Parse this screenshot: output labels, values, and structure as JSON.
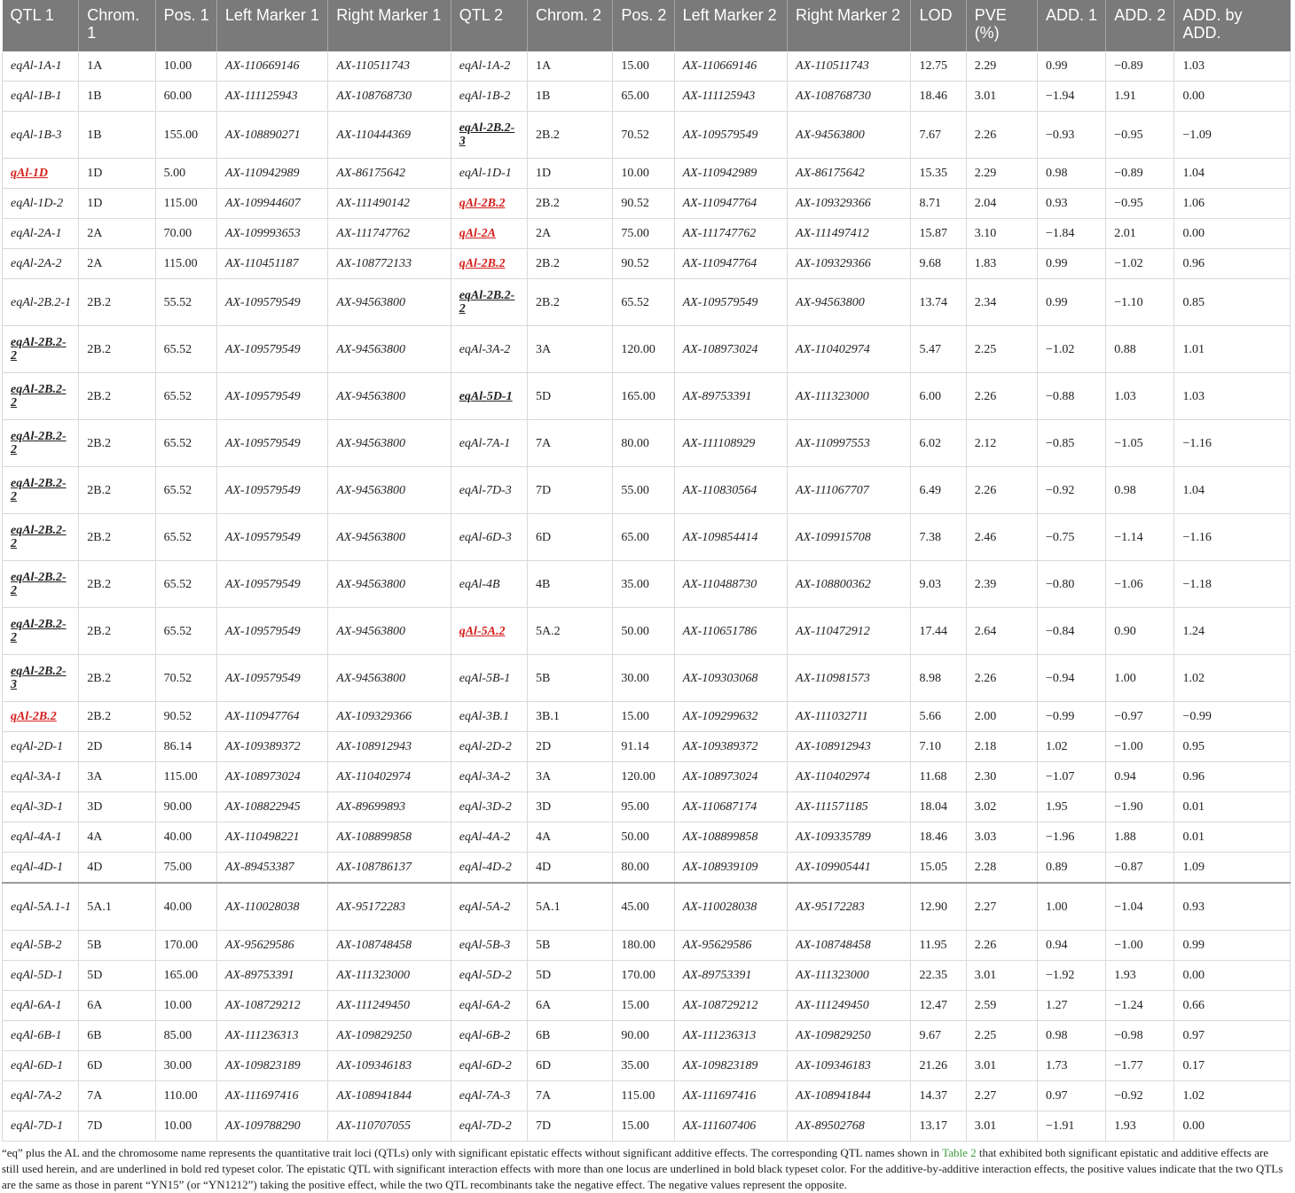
{
  "headers": [
    "QTL 1",
    "Chrom. 1",
    "Pos. 1",
    "Left Marker 1",
    "Right Marker 1",
    "QTL 2",
    "Chrom. 2",
    "Pos. 2",
    "Left Marker 2",
    "Right Marker 2",
    "LOD",
    "PVE (%)",
    "ADD. 1",
    "ADD. 2",
    "ADD. by ADD."
  ],
  "rows": [
    {
      "h": 1,
      "q1": {
        "t": "eqAl-1A-1",
        "s": ""
      },
      "c1": "1A",
      "p1": "10.00",
      "l1": "AX-110669146",
      "r1": "AX-110511743",
      "q2": {
        "t": "eqAl-1A-2",
        "s": ""
      },
      "c2": "1A",
      "p2": "15.00",
      "l2": "AX-110669146",
      "r2": "AX-110511743",
      "lod": "12.75",
      "pve": "2.29",
      "a1": "0.99",
      "a2": "−0.89",
      "aa": "1.03"
    },
    {
      "h": 1,
      "q1": {
        "t": "eqAl-1B-1",
        "s": ""
      },
      "c1": "1B",
      "p1": "60.00",
      "l1": "AX-111125943",
      "r1": "AX-108768730",
      "q2": {
        "t": "eqAl-1B-2",
        "s": ""
      },
      "c2": "1B",
      "p2": "65.00",
      "l2": "AX-111125943",
      "r2": "AX-108768730",
      "lod": "18.46",
      "pve": "3.01",
      "a1": "−1.94",
      "a2": "1.91",
      "aa": "0.00"
    },
    {
      "h": 2,
      "q1": {
        "t": "eqAl-1B-3",
        "s": ""
      },
      "c1": "1B",
      "p1": "155.00",
      "l1": "AX-108890271",
      "r1": "AX-110444369",
      "q2": {
        "t": "eqAl-2B.2-3",
        "s": "blk"
      },
      "c2": "2B.2",
      "p2": "70.52",
      "l2": "AX-109579549",
      "r2": "AX-94563800",
      "lod": "7.67",
      "pve": "2.26",
      "a1": "−0.93",
      "a2": "−0.95",
      "aa": "−1.09"
    },
    {
      "h": 1,
      "q1": {
        "t": "qAl-1D",
        "s": "red"
      },
      "c1": "1D",
      "p1": "5.00",
      "l1": "AX-110942989",
      "r1": "AX-86175642",
      "q2": {
        "t": "eqAl-1D-1",
        "s": ""
      },
      "c2": "1D",
      "p2": "10.00",
      "l2": "AX-110942989",
      "r2": "AX-86175642",
      "lod": "15.35",
      "pve": "2.29",
      "a1": "0.98",
      "a2": "−0.89",
      "aa": "1.04"
    },
    {
      "h": 1,
      "q1": {
        "t": "eqAl-1D-2",
        "s": ""
      },
      "c1": "1D",
      "p1": "115.00",
      "l1": "AX-109944607",
      "r1": "AX-111490142",
      "q2": {
        "t": "qAl-2B.2",
        "s": "red"
      },
      "c2": "2B.2",
      "p2": "90.52",
      "l2": "AX-110947764",
      "r2": "AX-109329366",
      "lod": "8.71",
      "pve": "2.04",
      "a1": "0.93",
      "a2": "−0.95",
      "aa": "1.06"
    },
    {
      "h": 1,
      "q1": {
        "t": "eqAl-2A-1",
        "s": ""
      },
      "c1": "2A",
      "p1": "70.00",
      "l1": "AX-109993653",
      "r1": "AX-111747762",
      "q2": {
        "t": "qAl-2A",
        "s": "red"
      },
      "c2": "2A",
      "p2": "75.00",
      "l2": "AX-111747762",
      "r2": "AX-111497412",
      "lod": "15.87",
      "pve": "3.10",
      "a1": "−1.84",
      "a2": "2.01",
      "aa": "0.00"
    },
    {
      "h": 1,
      "q1": {
        "t": "eqAl-2A-2",
        "s": ""
      },
      "c1": "2A",
      "p1": "115.00",
      "l1": "AX-110451187",
      "r1": "AX-108772133",
      "q2": {
        "t": "qAl-2B.2",
        "s": "red"
      },
      "c2": "2B.2",
      "p2": "90.52",
      "l2": "AX-110947764",
      "r2": "AX-109329366",
      "lod": "9.68",
      "pve": "1.83",
      "a1": "0.99",
      "a2": "−1.02",
      "aa": "0.96"
    },
    {
      "h": 2,
      "q1": {
        "t": "eqAl-2B.2-1",
        "s": ""
      },
      "c1": "2B.2",
      "p1": "55.52",
      "l1": "AX-109579549",
      "r1": "AX-94563800",
      "q2": {
        "t": "eqAl-2B.2-2",
        "s": "blk"
      },
      "c2": "2B.2",
      "p2": "65.52",
      "l2": "AX-109579549",
      "r2": "AX-94563800",
      "lod": "13.74",
      "pve": "2.34",
      "a1": "0.99",
      "a2": "−1.10",
      "aa": "0.85"
    },
    {
      "h": 2,
      "q1": {
        "t": "eqAl-2B.2-2",
        "s": "blk"
      },
      "c1": "2B.2",
      "p1": "65.52",
      "l1": "AX-109579549",
      "r1": "AX-94563800",
      "q2": {
        "t": "eqAl-3A-2",
        "s": ""
      },
      "c2": "3A",
      "p2": "120.00",
      "l2": "AX-108973024",
      "r2": "AX-110402974",
      "lod": "5.47",
      "pve": "2.25",
      "a1": "−1.02",
      "a2": "0.88",
      "aa": "1.01"
    },
    {
      "h": 2,
      "q1": {
        "t": "eqAl-2B.2-2",
        "s": "blk"
      },
      "c1": "2B.2",
      "p1": "65.52",
      "l1": "AX-109579549",
      "r1": "AX-94563800",
      "q2": {
        "t": "eqAl-5D-1",
        "s": "blk"
      },
      "c2": "5D",
      "p2": "165.00",
      "l2": "AX-89753391",
      "r2": "AX-111323000",
      "lod": "6.00",
      "pve": "2.26",
      "a1": "−0.88",
      "a2": "1.03",
      "aa": "1.03"
    },
    {
      "h": 2,
      "q1": {
        "t": "eqAl-2B.2-2",
        "s": "blk"
      },
      "c1": "2B.2",
      "p1": "65.52",
      "l1": "AX-109579549",
      "r1": "AX-94563800",
      "q2": {
        "t": "eqAl-7A-1",
        "s": ""
      },
      "c2": "7A",
      "p2": "80.00",
      "l2": "AX-111108929",
      "r2": "AX-110997553",
      "lod": "6.02",
      "pve": "2.12",
      "a1": "−0.85",
      "a2": "−1.05",
      "aa": "−1.16"
    },
    {
      "h": 2,
      "q1": {
        "t": "eqAl-2B.2-2",
        "s": "blk"
      },
      "c1": "2B.2",
      "p1": "65.52",
      "l1": "AX-109579549",
      "r1": "AX-94563800",
      "q2": {
        "t": "eqAl-7D-3",
        "s": ""
      },
      "c2": "7D",
      "p2": "55.00",
      "l2": "AX-110830564",
      "r2": "AX-111067707",
      "lod": "6.49",
      "pve": "2.26",
      "a1": "−0.92",
      "a2": "0.98",
      "aa": "1.04"
    },
    {
      "h": 2,
      "q1": {
        "t": "eqAl-2B.2-2",
        "s": "blk"
      },
      "c1": "2B.2",
      "p1": "65.52",
      "l1": "AX-109579549",
      "r1": "AX-94563800",
      "q2": {
        "t": "eqAl-6D-3",
        "s": ""
      },
      "c2": "6D",
      "p2": "65.00",
      "l2": "AX-109854414",
      "r2": "AX-109915708",
      "lod": "7.38",
      "pve": "2.46",
      "a1": "−0.75",
      "a2": "−1.14",
      "aa": "−1.16"
    },
    {
      "h": 2,
      "q1": {
        "t": "eqAl-2B.2-2",
        "s": "blk"
      },
      "c1": "2B.2",
      "p1": "65.52",
      "l1": "AX-109579549",
      "r1": "AX-94563800",
      "q2": {
        "t": "eqAl-4B",
        "s": ""
      },
      "c2": "4B",
      "p2": "35.00",
      "l2": "AX-110488730",
      "r2": "AX-108800362",
      "lod": "9.03",
      "pve": "2.39",
      "a1": "−0.80",
      "a2": "−1.06",
      "aa": "−1.18"
    },
    {
      "h": 2,
      "q1": {
        "t": "eqAl-2B.2-2",
        "s": "blk"
      },
      "c1": "2B.2",
      "p1": "65.52",
      "l1": "AX-109579549",
      "r1": "AX-94563800",
      "q2": {
        "t": "qAl-5A.2",
        "s": "red"
      },
      "c2": "5A.2",
      "p2": "50.00",
      "l2": "AX-110651786",
      "r2": "AX-110472912",
      "lod": "17.44",
      "pve": "2.64",
      "a1": "−0.84",
      "a2": "0.90",
      "aa": "1.24"
    },
    {
      "h": 2,
      "q1": {
        "t": "eqAl-2B.2-3",
        "s": "blk"
      },
      "c1": "2B.2",
      "p1": "70.52",
      "l1": "AX-109579549",
      "r1": "AX-94563800",
      "q2": {
        "t": "eqAl-5B-1",
        "s": ""
      },
      "c2": "5B",
      "p2": "30.00",
      "l2": "AX-109303068",
      "r2": "AX-110981573",
      "lod": "8.98",
      "pve": "2.26",
      "a1": "−0.94",
      "a2": "1.00",
      "aa": "1.02"
    },
    {
      "h": 1,
      "q1": {
        "t": "qAl-2B.2",
        "s": "red"
      },
      "c1": "2B.2",
      "p1": "90.52",
      "l1": "AX-110947764",
      "r1": "AX-109329366",
      "q2": {
        "t": "eqAl-3B.1",
        "s": ""
      },
      "c2": "3B.1",
      "p2": "15.00",
      "l2": "AX-109299632",
      "r2": "AX-111032711",
      "lod": "5.66",
      "pve": "2.00",
      "a1": "−0.99",
      "a2": "−0.97",
      "aa": "−0.99"
    },
    {
      "h": 1,
      "q1": {
        "t": "eqAl-2D-1",
        "s": ""
      },
      "c1": "2D",
      "p1": "86.14",
      "l1": "AX-109389372",
      "r1": "AX-108912943",
      "q2": {
        "t": "eqAl-2D-2",
        "s": ""
      },
      "c2": "2D",
      "p2": "91.14",
      "l2": "AX-109389372",
      "r2": "AX-108912943",
      "lod": "7.10",
      "pve": "2.18",
      "a1": "1.02",
      "a2": "−1.00",
      "aa": "0.95"
    },
    {
      "h": 1,
      "q1": {
        "t": "eqAl-3A-1",
        "s": ""
      },
      "c1": "3A",
      "p1": "115.00",
      "l1": "AX-108973024",
      "r1": "AX-110402974",
      "q2": {
        "t": "eqAl-3A-2",
        "s": ""
      },
      "c2": "3A",
      "p2": "120.00",
      "l2": "AX-108973024",
      "r2": "AX-110402974",
      "lod": "11.68",
      "pve": "2.30",
      "a1": "−1.07",
      "a2": "0.94",
      "aa": "0.96"
    },
    {
      "h": 1,
      "q1": {
        "t": "eqAl-3D-1",
        "s": ""
      },
      "c1": "3D",
      "p1": "90.00",
      "l1": "AX-108822945",
      "r1": "AX-89699893",
      "q2": {
        "t": "eqAl-3D-2",
        "s": ""
      },
      "c2": "3D",
      "p2": "95.00",
      "l2": "AX-110687174",
      "r2": "AX-111571185",
      "lod": "18.04",
      "pve": "3.02",
      "a1": "1.95",
      "a2": "−1.90",
      "aa": "0.01"
    },
    {
      "h": 1,
      "q1": {
        "t": "eqAl-4A-1",
        "s": ""
      },
      "c1": "4A",
      "p1": "40.00",
      "l1": "AX-110498221",
      "r1": "AX-108899858",
      "q2": {
        "t": "eqAl-4A-2",
        "s": ""
      },
      "c2": "4A",
      "p2": "50.00",
      "l2": "AX-108899858",
      "r2": "AX-109335789",
      "lod": "18.46",
      "pve": "3.03",
      "a1": "−1.96",
      "a2": "1.88",
      "aa": "0.01"
    },
    {
      "h": 1,
      "q1": {
        "t": "eqAl-4D-1",
        "s": ""
      },
      "c1": "4D",
      "p1": "75.00",
      "l1": "AX-89453387",
      "r1": "AX-108786137",
      "q2": {
        "t": "eqAl-4D-2",
        "s": ""
      },
      "c2": "4D",
      "p2": "80.00",
      "l2": "AX-108939109",
      "r2": "AX-109905441",
      "lod": "15.05",
      "pve": "2.28",
      "a1": "0.89",
      "a2": "−0.87",
      "aa": "1.09"
    },
    {
      "h": 2,
      "sep": true,
      "q1": {
        "t": "eqAl-5A.1-1",
        "s": ""
      },
      "c1": "5A.1",
      "p1": "40.00",
      "l1": "AX-110028038",
      "r1": "AX-95172283",
      "q2": {
        "t": "eqAl-5A-2",
        "s": ""
      },
      "c2": "5A.1",
      "p2": "45.00",
      "l2": "AX-110028038",
      "r2": "AX-95172283",
      "lod": "12.90",
      "pve": "2.27",
      "a1": "1.00",
      "a2": "−1.04",
      "aa": "0.93"
    },
    {
      "h": 1,
      "q1": {
        "t": "eqAl-5B-2",
        "s": ""
      },
      "c1": "5B",
      "p1": "170.00",
      "l1": "AX-95629586",
      "r1": "AX-108748458",
      "q2": {
        "t": "eqAl-5B-3",
        "s": ""
      },
      "c2": "5B",
      "p2": "180.00",
      "l2": "AX-95629586",
      "r2": "AX-108748458",
      "lod": "11.95",
      "pve": "2.26",
      "a1": "0.94",
      "a2": "−1.00",
      "aa": "0.99"
    },
    {
      "h": 1,
      "q1": {
        "t": "eqAl-5D-1",
        "s": ""
      },
      "c1": "5D",
      "p1": "165.00",
      "l1": "AX-89753391",
      "r1": "AX-111323000",
      "q2": {
        "t": "eqAl-5D-2",
        "s": ""
      },
      "c2": "5D",
      "p2": "170.00",
      "l2": "AX-89753391",
      "r2": "AX-111323000",
      "lod": "22.35",
      "pve": "3.01",
      "a1": "−1.92",
      "a2": "1.93",
      "aa": "0.00"
    },
    {
      "h": 1,
      "q1": {
        "t": "eqAl-6A-1",
        "s": ""
      },
      "c1": "6A",
      "p1": "10.00",
      "l1": "AX-108729212",
      "r1": "AX-111249450",
      "q2": {
        "t": "eqAl-6A-2",
        "s": ""
      },
      "c2": "6A",
      "p2": "15.00",
      "l2": "AX-108729212",
      "r2": "AX-111249450",
      "lod": "12.47",
      "pve": "2.59",
      "a1": "1.27",
      "a2": "−1.24",
      "aa": "0.66"
    },
    {
      "h": 1,
      "q1": {
        "t": "eqAl-6B-1",
        "s": ""
      },
      "c1": "6B",
      "p1": "85.00",
      "l1": "AX-111236313",
      "r1": "AX-109829250",
      "q2": {
        "t": "eqAl-6B-2",
        "s": ""
      },
      "c2": "6B",
      "p2": "90.00",
      "l2": "AX-111236313",
      "r2": "AX-109829250",
      "lod": "9.67",
      "pve": "2.25",
      "a1": "0.98",
      "a2": "−0.98",
      "aa": "0.97"
    },
    {
      "h": 1,
      "q1": {
        "t": "eqAl-6D-1",
        "s": ""
      },
      "c1": "6D",
      "p1": "30.00",
      "l1": "AX-109823189",
      "r1": "AX-109346183",
      "q2": {
        "t": "eqAl-6D-2",
        "s": ""
      },
      "c2": "6D",
      "p2": "35.00",
      "l2": "AX-109823189",
      "r2": "AX-109346183",
      "lod": "21.26",
      "pve": "3.01",
      "a1": "1.73",
      "a2": "−1.77",
      "aa": "0.17"
    },
    {
      "h": 1,
      "q1": {
        "t": "eqAl-7A-2",
        "s": ""
      },
      "c1": "7A",
      "p1": "110.00",
      "l1": "AX-111697416",
      "r1": "AX-108941844",
      "q2": {
        "t": "eqAl-7A-3",
        "s": ""
      },
      "c2": "7A",
      "p2": "115.00",
      "l2": "AX-111697416",
      "r2": "AX-108941844",
      "lod": "14.37",
      "pve": "2.27",
      "a1": "0.97",
      "a2": "−0.92",
      "aa": "1.02"
    },
    {
      "h": 1,
      "q1": {
        "t": "eqAl-7D-1",
        "s": ""
      },
      "c1": "7D",
      "p1": "10.00",
      "l1": "AX-109788290",
      "r1": "AX-110707055",
      "q2": {
        "t": "eqAl-7D-2",
        "s": ""
      },
      "c2": "7D",
      "p2": "15.00",
      "l2": "AX-111607406",
      "r2": "AX-89502768",
      "lod": "13.17",
      "pve": "3.01",
      "a1": "−1.91",
      "a2": "1.93",
      "aa": "0.00"
    }
  ],
  "footnote": {
    "before_link": "“eq” plus the AL and the chromosome name represents the quantitative trait loci (QTLs) only with significant epistatic effects without significant additive effects. The corresponding QTL names shown in ",
    "link": "Table 2",
    "after_link": " that exhibited both significant epistatic and additive effects are still used herein, and are underlined in bold red typeset color. The epistatic QTL with significant interaction effects with more than one locus are underlined in bold black typeset color. For the additive-by-additive interaction effects, the positive values indicate that the two QTLs are the same as those in parent “YN15” (or “YN1212”) taking the positive effect, while the two QTL recombinants take the negative effect. The negative values represent the opposite."
  },
  "colors": {
    "header_bg": "#7a7a7a",
    "highlight_red": "#d4201d",
    "link_green": "#3b9c3b"
  }
}
